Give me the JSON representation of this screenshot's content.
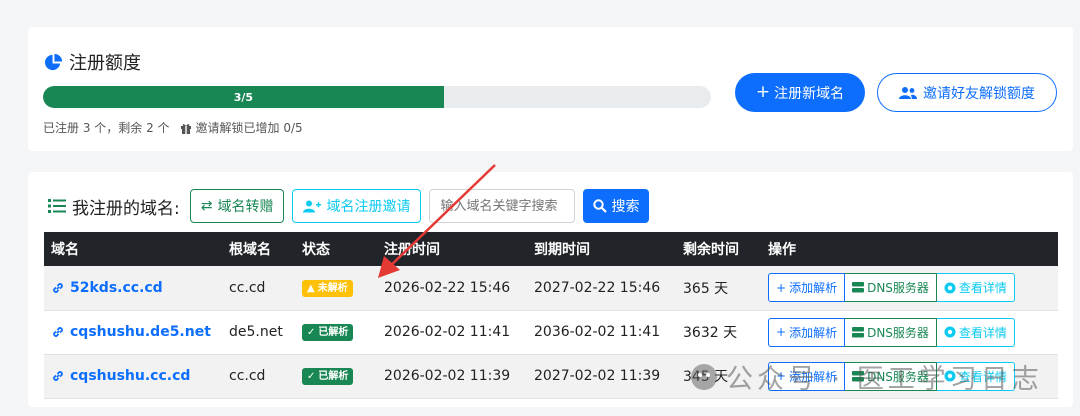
{
  "quota": {
    "title": "注册额度",
    "progress_label": "3/5",
    "progress_fraction": 0.6,
    "summary": "已注册 3 个，剩余 2 个",
    "invite_summary": "邀请解锁已增加 0/5",
    "register_button": "注册新域名",
    "invite_button": "邀请好友解锁额度"
  },
  "domains": {
    "title": "我注册的域名:",
    "transfer_button": "域名转赠",
    "invite_register_button": "域名注册邀请",
    "search_placeholder": "输入域名关键字搜索",
    "search_button": "搜索",
    "columns": [
      "域名",
      "根域名",
      "状态",
      "注册时间",
      "到期时间",
      "剩余时间",
      "操作"
    ],
    "rows": [
      {
        "domain": "52kds.cc.cd",
        "root": "cc.cd",
        "status": "未解析",
        "status_type": "warning",
        "registered": "2026-02-22 15:46",
        "expires": "2027-02-22 15:46",
        "remaining": "365 天"
      },
      {
        "domain": "cqshushu.de5.net",
        "root": "de5.net",
        "status": "已解析",
        "status_type": "success",
        "registered": "2026-02-02 11:41",
        "expires": "2036-02-02 11:41",
        "remaining": "3632 天"
      },
      {
        "domain": "cqshushu.cc.cd",
        "root": "cc.cd",
        "status": "已解析",
        "status_type": "success",
        "registered": "2026-02-02 11:39",
        "expires": "2027-02-02 11:39",
        "remaining": "345 天"
      }
    ],
    "actions": {
      "add": "添加解析",
      "dns": "DNS服务器",
      "detail": "查看详情"
    }
  },
  "watermark": "公众号 · 医工学习日志",
  "colors": {
    "primary": "#0d6efd",
    "success": "#198754",
    "info": "#0dcaf0",
    "warning": "#ffc107",
    "dark": "#212529"
  }
}
